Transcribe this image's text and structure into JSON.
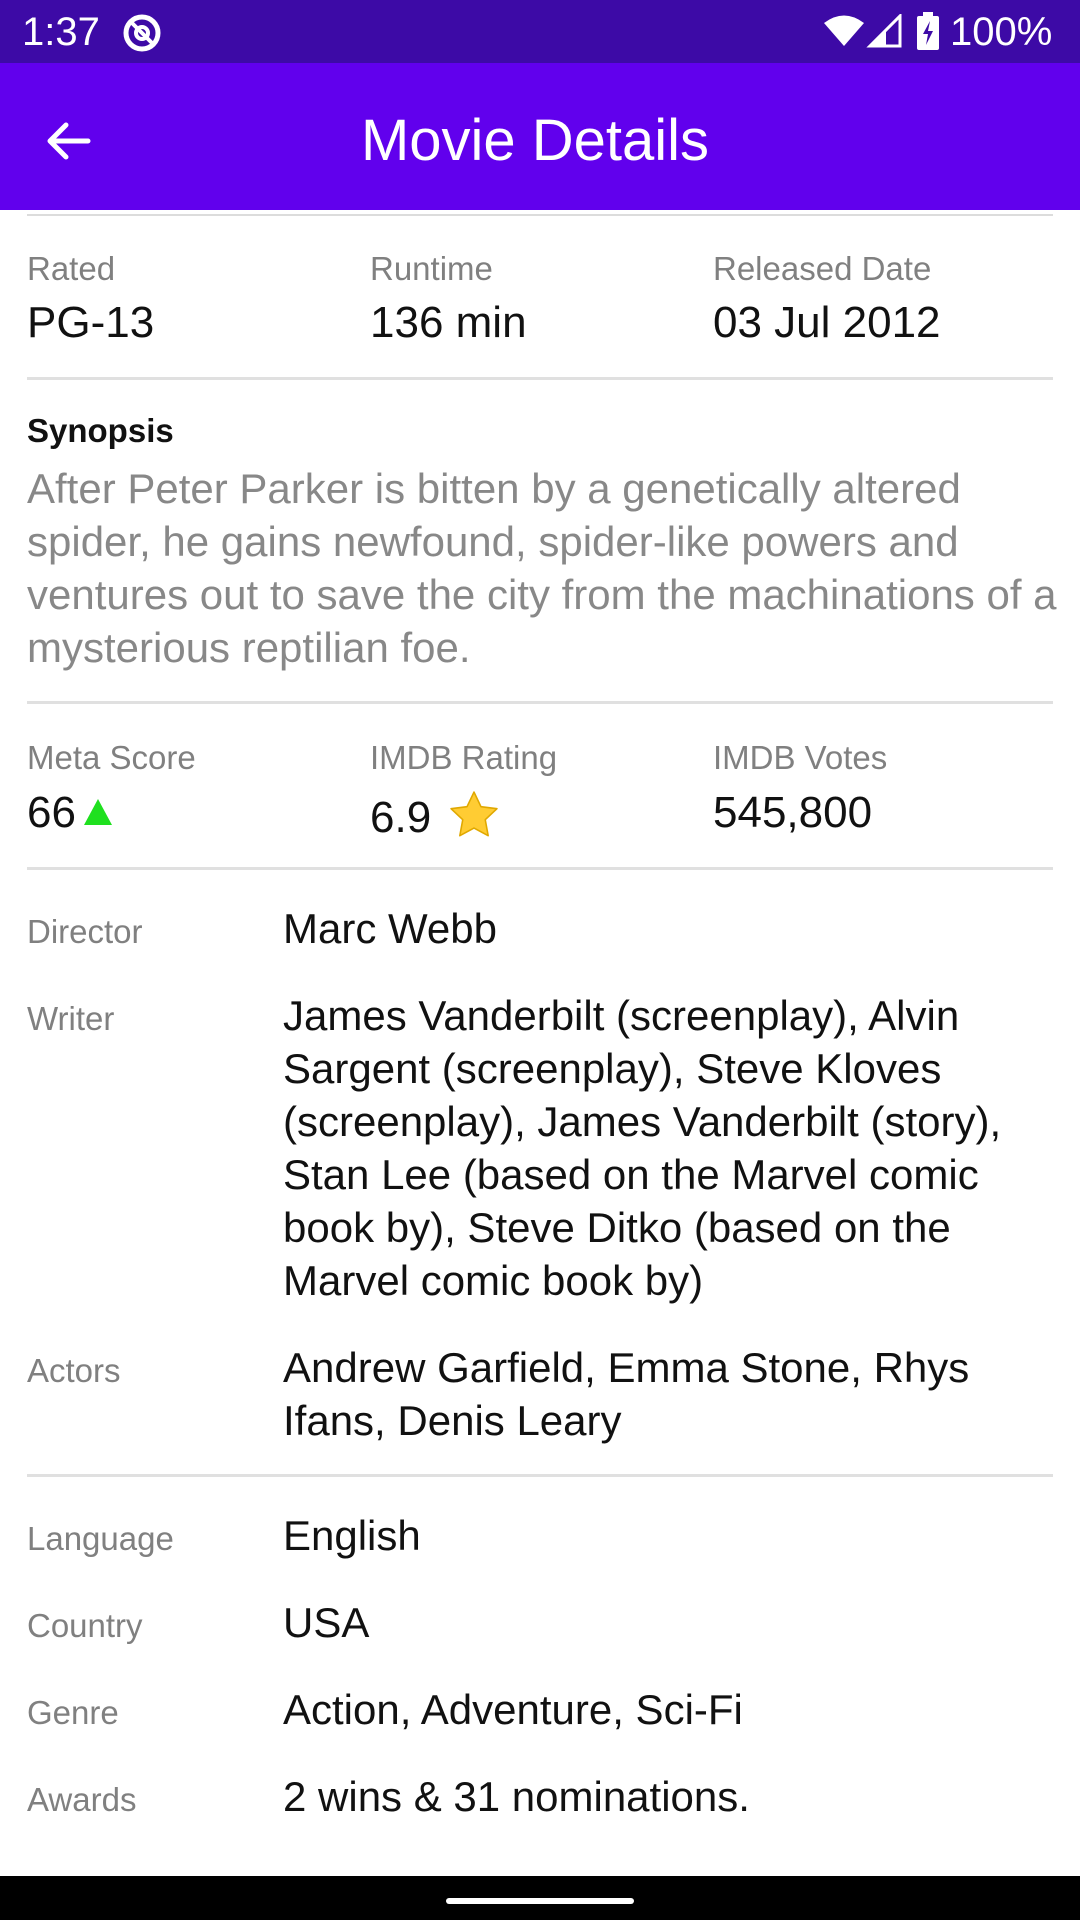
{
  "status_bar": {
    "time": "1:37",
    "battery": "100%",
    "icons": [
      "do-not-disturb-icon",
      "wifi-icon",
      "cell-signal-icon",
      "battery-charging-icon"
    ]
  },
  "app_bar": {
    "title": "Movie Details",
    "back_icon": "arrow-back-icon",
    "color": "#6100ed",
    "status_color": "#3d0aa6"
  },
  "info": {
    "rated_label": "Rated",
    "rated_value": "PG-13",
    "runtime_label": "Runtime",
    "runtime_value": "136 min",
    "released_label": "Released Date",
    "released_value": "03 Jul 2012"
  },
  "synopsis": {
    "title": "Synopsis",
    "text": "After Peter Parker is bitten by a genetically altered spider, he gains newfound, spider-like powers and ventures out to save the city from the machinations of a mysterious reptilian foe."
  },
  "scores": {
    "meta_label": "Meta Score",
    "meta_value": "66",
    "meta_icon": "up-triangle-icon",
    "imdb_rating_label": "IMDB Rating",
    "imdb_rating_value": "6.9",
    "imdb_rating_icon": "star-icon",
    "imdb_votes_label": "IMDB Votes",
    "imdb_votes_value": "545,800"
  },
  "people": {
    "director_label": "Director",
    "director_value": "Marc Webb",
    "writer_label": "Writer",
    "writer_value": "James Vanderbilt (screenplay), Alvin Sargent (screenplay), Steve Kloves (screenplay), James Vanderbilt (story), Stan Lee (based on the Marvel comic book by), Steve Ditko (based on the Marvel comic book by)",
    "actors_label": "Actors",
    "actors_value": "Andrew Garfield, Emma Stone, Rhys Ifans, Denis Leary"
  },
  "details": {
    "language_label": "Language",
    "language_value": "English",
    "country_label": "Country",
    "country_value": "USA",
    "genre_label": "Genre",
    "genre_value": "Action, Adventure, Sci-Fi",
    "awards_label": "Awards",
    "awards_value": "2 wins & 31 nominations."
  }
}
